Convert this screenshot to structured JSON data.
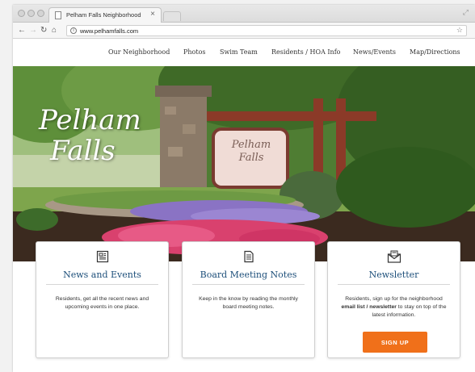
{
  "browser": {
    "tab_title": "Pelham Falls Neighborhood",
    "tab_close": "×",
    "url": "www.pelhamfalls.com"
  },
  "nav": {
    "items": [
      "Our Neighborhood",
      "Photos",
      "Swim Team",
      "Residents / HOA Info",
      "News/Events",
      "Map/Directions"
    ]
  },
  "hero": {
    "title_line1": "Pelham",
    "title_line2": "Falls",
    "sign_line1": "Pelham",
    "sign_line2": "Falls"
  },
  "cards": [
    {
      "title": "News and Events",
      "icon": "newspaper-icon",
      "text": "Residents, get all the recent news and upcoming events in one place."
    },
    {
      "title": "Board Meeting Notes",
      "icon": "document-icon",
      "text": "Keep in the know by reading the monthly board meeting notes."
    },
    {
      "title": "Newsletter",
      "icon": "envelope-icon",
      "text_before": "Residents, sign up for the neighborhood ",
      "text_bold": "email list / newsletter",
      "text_after": " to stay on top of the latest information.",
      "button_label": "SIGN UP",
      "button_color": "#f0701a"
    }
  ],
  "colors": {
    "card_title": "#1d4f7a",
    "accent": "#f0701a"
  }
}
